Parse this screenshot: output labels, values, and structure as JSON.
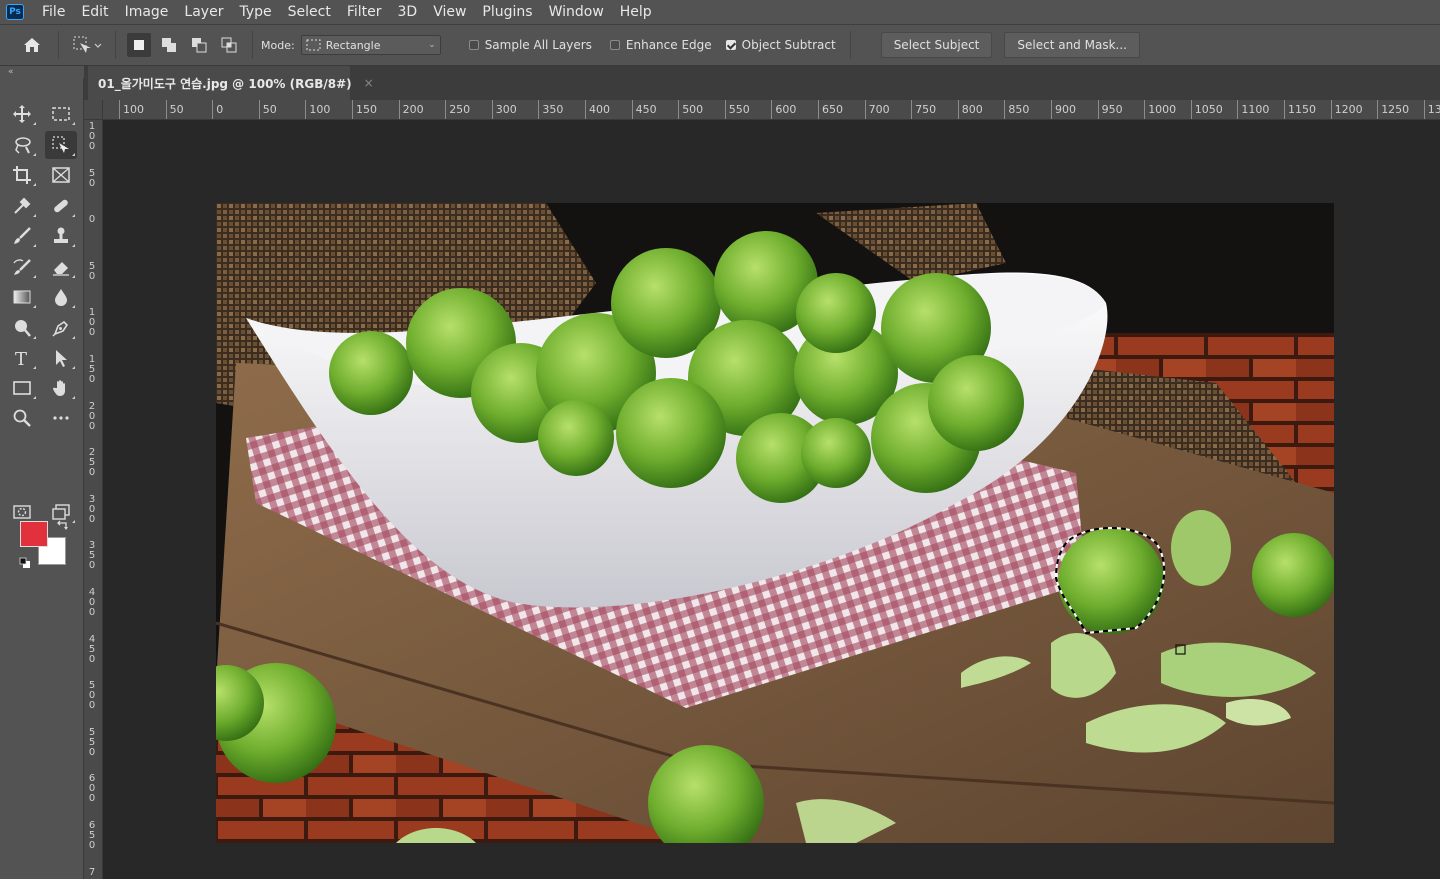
{
  "menubar": {
    "logo": "Ps",
    "items": [
      "File",
      "Edit",
      "Image",
      "Layer",
      "Type",
      "Select",
      "Filter",
      "3D",
      "View",
      "Plugins",
      "Window",
      "Help"
    ]
  },
  "options": {
    "mode_label": "Mode:",
    "mode_value": "Rectangle",
    "sample_all_layers": "Sample All Layers",
    "enhance_edge": "Enhance Edge",
    "object_subtract": "Object Subtract",
    "select_subject": "Select Subject",
    "select_and_mask": "Select and Mask..."
  },
  "document": {
    "tab_title": "01_올가미도구 연습.jpg @ 100% (RGB/8#)",
    "close": "×"
  },
  "rulers": {
    "horizontal": [
      "100",
      "50",
      "0",
      "50",
      "100",
      "150",
      "200",
      "250",
      "300",
      "350",
      "400",
      "450",
      "500",
      "550",
      "600",
      "650",
      "700",
      "750",
      "800",
      "850",
      "900",
      "950",
      "1000",
      "1050",
      "1100",
      "1150",
      "1200",
      "1250",
      "13"
    ],
    "vertical": [
      "100",
      "50",
      "0",
      "50",
      "100",
      "150",
      "200",
      "250",
      "300",
      "350",
      "400",
      "450",
      "500",
      "550",
      "600",
      "650",
      "7"
    ]
  },
  "colors": {
    "foreground": "#e0313d",
    "background": "#ffffff"
  }
}
